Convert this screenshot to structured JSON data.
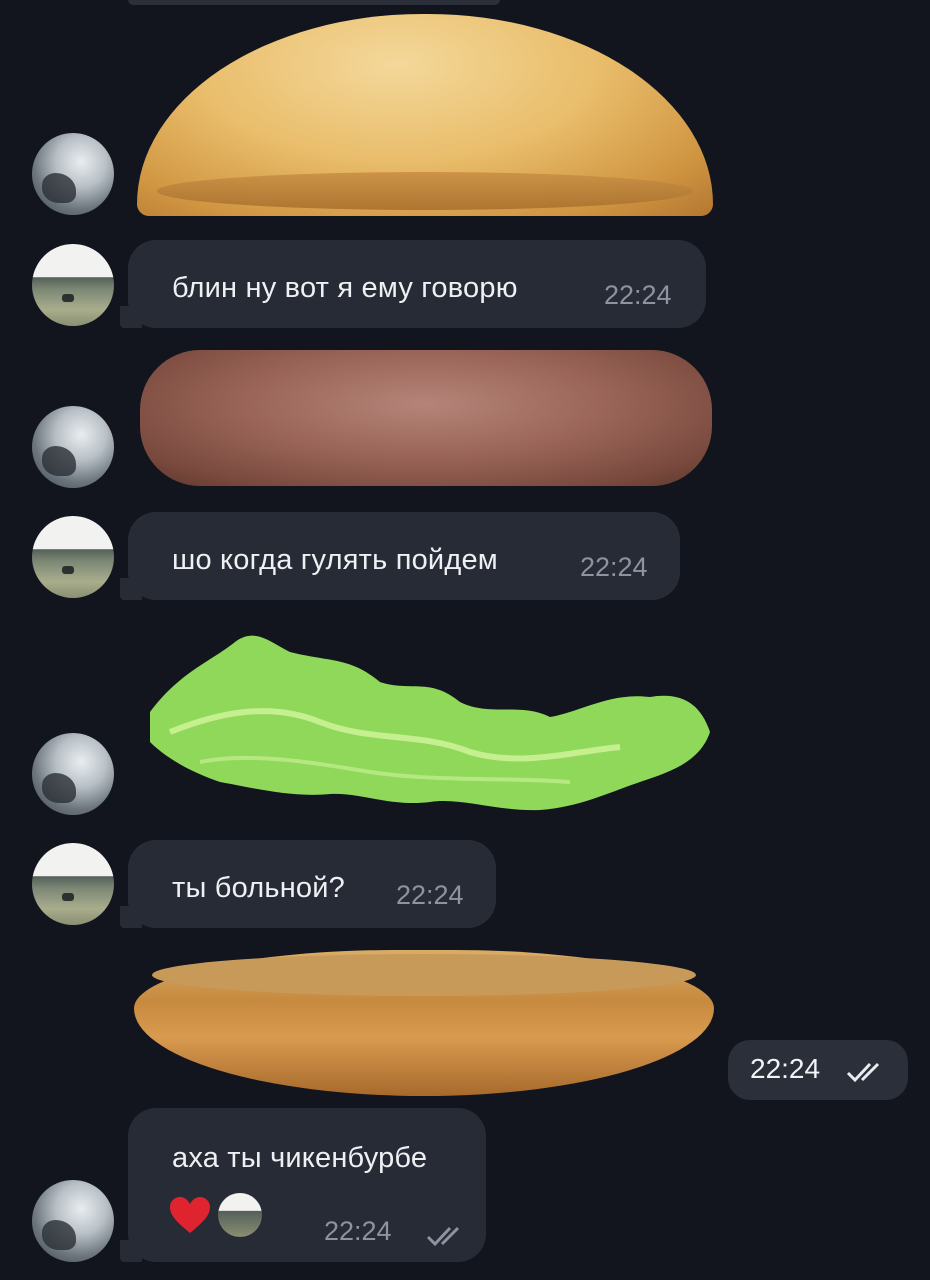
{
  "messages": [
    {
      "kind": "sticker",
      "name": "top bun"
    },
    {
      "kind": "text",
      "text": "блин ну вот я ему говорю",
      "time": "22:24"
    },
    {
      "kind": "sticker",
      "name": "patty"
    },
    {
      "kind": "text",
      "text": "шо когда гулять пойдем",
      "time": "22:24"
    },
    {
      "kind": "sticker",
      "name": "lettuce"
    },
    {
      "kind": "text",
      "text": "ты больной?",
      "time": "22:24"
    },
    {
      "kind": "sticker",
      "name": "bottom bun",
      "time": "22:24"
    },
    {
      "kind": "text",
      "text": "аха ты чикенбурбе",
      "time": "22:24"
    }
  ],
  "reaction_icon": "heart-icon",
  "read_status_icon": "double-check-icon",
  "colors": {
    "background": "#12151d",
    "bubble": "#272b35",
    "time": "#8d93a0",
    "heart": "#e0242f"
  }
}
